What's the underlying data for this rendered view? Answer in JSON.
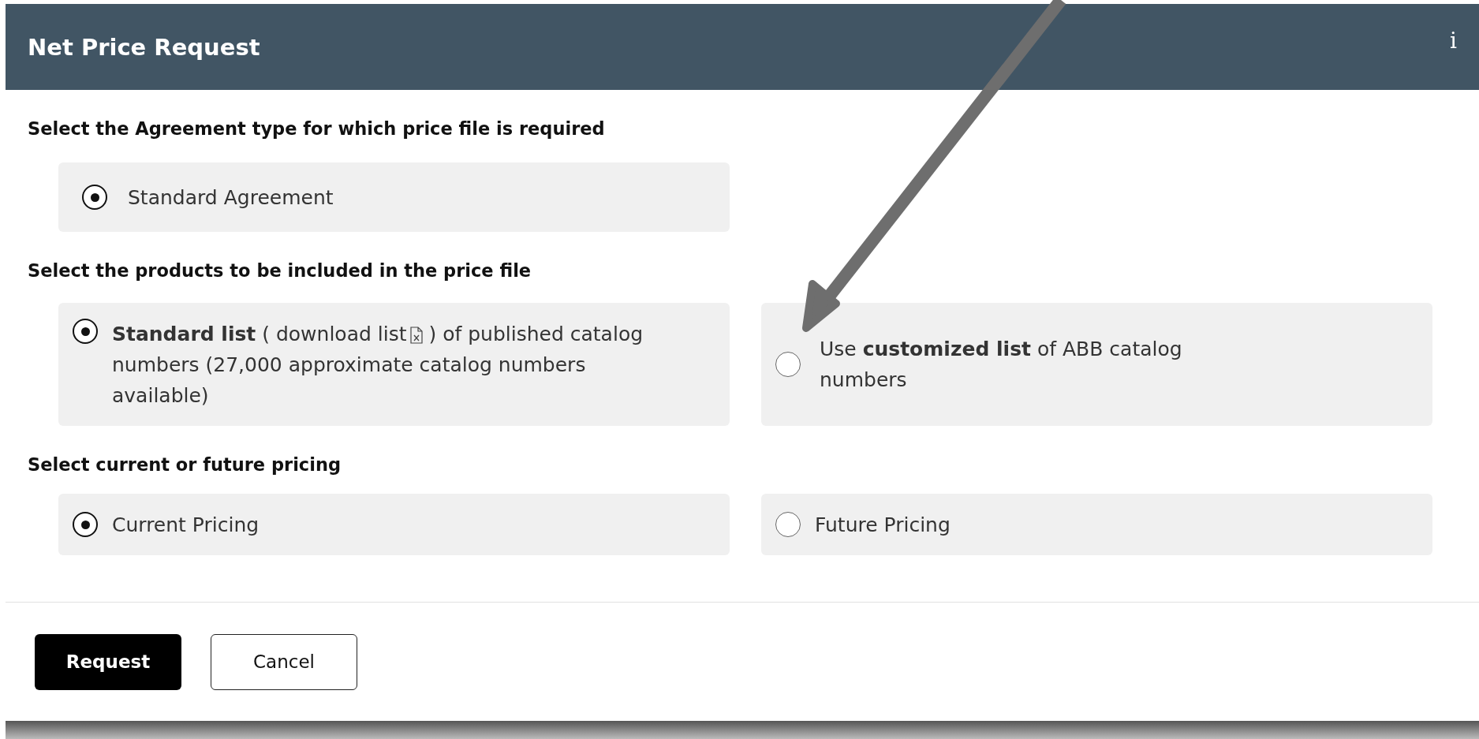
{
  "window": {
    "title": "Net Price Request",
    "info": "i"
  },
  "sections": [
    {
      "heading": "Select the Agreement type for which price file is required",
      "options": [
        {
          "kind": "plain",
          "label": "Standard Agreement",
          "selected": true
        }
      ]
    },
    {
      "heading": "Select the products to be included in the price file",
      "options": [
        {
          "kind": "download",
          "before": "**Standard list** (",
          "link": "download list",
          "after": ") of published catalog numbers (27,000 approximate catalog numbers available)",
          "selected": true
        },
        {
          "kind": "plain",
          "label": "Use **customized list** of ABB catalog numbers",
          "selected": false
        }
      ]
    },
    {
      "heading": "Select current or future pricing",
      "options": [
        {
          "kind": "plain",
          "label": "Current Pricing",
          "selected": true
        },
        {
          "kind": "plain",
          "label": "Future Pricing",
          "selected": false
        }
      ]
    }
  ],
  "buttons": [
    {
      "kind": "primary",
      "label": "Request"
    },
    {
      "kind": "secondary",
      "label": "Cancel"
    }
  ]
}
